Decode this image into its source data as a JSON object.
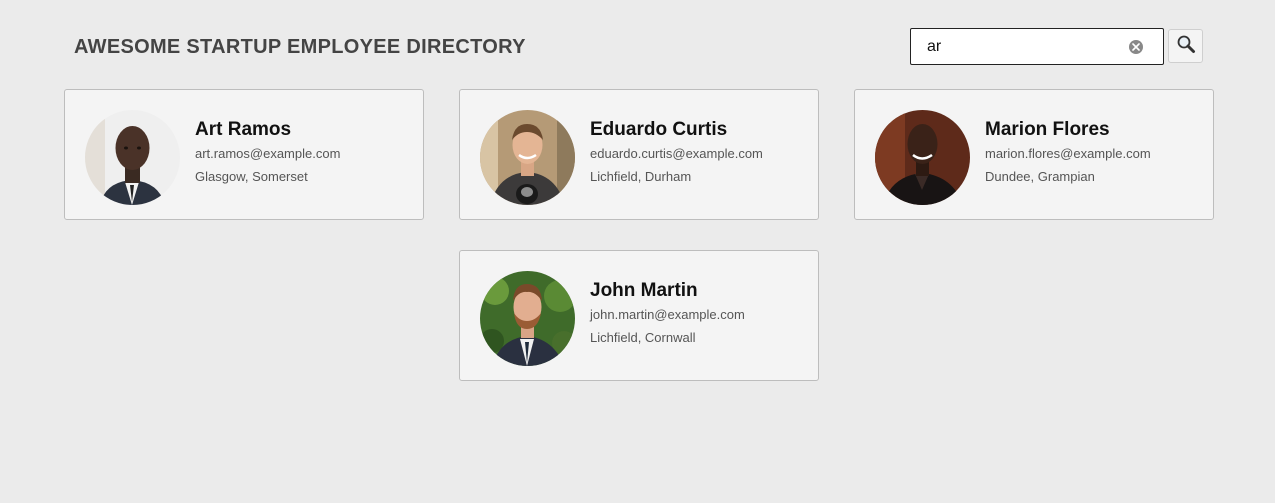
{
  "header": {
    "title": "AWESOME STARTUP EMPLOYEE DIRECTORY"
  },
  "search": {
    "value": "ar",
    "clear_icon": "clear-circle-icon",
    "button_icon": "magnifier-icon"
  },
  "employees": [
    {
      "name": "Art Ramos",
      "email": "art.ramos@example.com",
      "location": "Glasgow, Somerset",
      "avatar_icon": "avatar-photo"
    },
    {
      "name": "Eduardo Curtis",
      "email": "eduardo.curtis@example.com",
      "location": "Lichfield, Durham",
      "avatar_icon": "avatar-photo"
    },
    {
      "name": "Marion Flores",
      "email": "marion.flores@example.com",
      "location": "Dundee, Grampian",
      "avatar_icon": "avatar-photo"
    },
    {
      "name": "John Martin",
      "email": "john.martin@example.com",
      "location": "Lichfield, Cornwall",
      "avatar_icon": "avatar-photo"
    }
  ]
}
